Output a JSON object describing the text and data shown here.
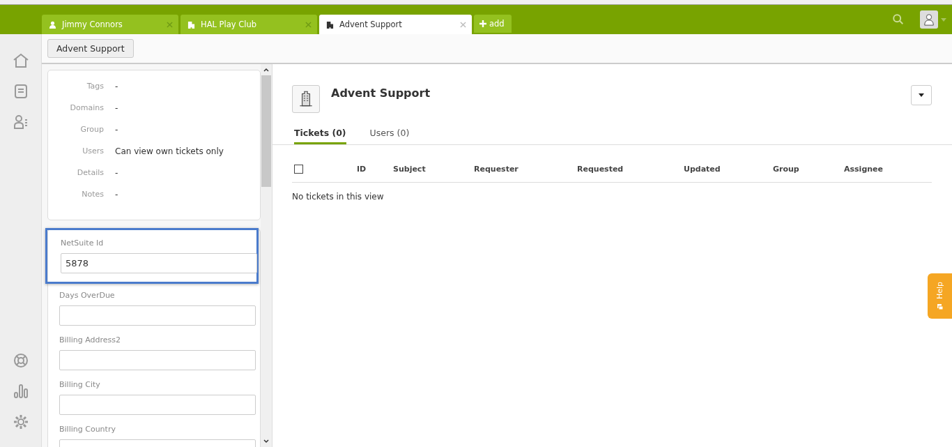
{
  "tabs": [
    {
      "label": "Jimmy Connors",
      "kind": "person",
      "selected": false
    },
    {
      "label": "HAL Play Club",
      "kind": "building",
      "selected": false
    },
    {
      "label": "Advent Support",
      "kind": "building",
      "selected": true
    }
  ],
  "add_tab": {
    "label": "add"
  },
  "toolbar": {
    "button": "Advent Support"
  },
  "properties": [
    {
      "label": "Tags",
      "value": "-"
    },
    {
      "label": "Domains",
      "value": "-"
    },
    {
      "label": "Group",
      "value": "-"
    },
    {
      "label": "Users",
      "value": "Can view own tickets only"
    },
    {
      "label": "Details",
      "value": "-"
    },
    {
      "label": "Notes",
      "value": "-"
    }
  ],
  "fields": [
    {
      "label": "NetSuite Id",
      "value": "5878",
      "focused": true
    },
    {
      "label": "Days OverDue",
      "focused": false
    },
    {
      "label": "Billing Address2",
      "focused": false
    },
    {
      "label": "Billing City",
      "focused": false
    },
    {
      "label": "Billing Country",
      "focused": false
    }
  ],
  "organization": {
    "name": "Advent Support"
  },
  "view_tabs": [
    {
      "label": "Tickets (0)",
      "selected": true
    },
    {
      "label": "Users (0)",
      "selected": false
    }
  ],
  "table": {
    "checked": false,
    "columns": [
      "ID",
      "Subject",
      "Requester",
      "Requested",
      "Updated",
      "Group",
      "Assignee"
    ],
    "empty_message": "No tickets in this view"
  },
  "help": {
    "label": "Help"
  }
}
